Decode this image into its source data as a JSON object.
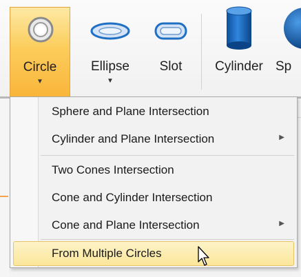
{
  "ribbon": {
    "buttons": [
      {
        "label": "Circle",
        "icon": "circle-icon",
        "has_dropdown": true,
        "active": true
      },
      {
        "label": "Ellipse",
        "icon": "ellipse-icon",
        "has_dropdown": true,
        "active": false
      },
      {
        "label": "Slot",
        "icon": "slot-icon",
        "has_dropdown": false,
        "active": false
      },
      {
        "label": "Cylinder",
        "icon": "cylinder-icon",
        "has_dropdown": false,
        "active": false
      },
      {
        "label": "Sp",
        "icon": "sphere-icon",
        "has_dropdown": false,
        "active": false
      }
    ]
  },
  "menu": {
    "items": [
      {
        "label": "Sphere and Plane Intersection",
        "submenu": false,
        "highlighted": false
      },
      {
        "label": "Cylinder and Plane Intersection",
        "submenu": true,
        "highlighted": false
      },
      {
        "label": "Two Cones Intersection",
        "submenu": false,
        "highlighted": false
      },
      {
        "label": "Cone and Cylinder Intersection",
        "submenu": false,
        "highlighted": false
      },
      {
        "label": "Cone and Plane Intersection",
        "submenu": true,
        "highlighted": false
      },
      {
        "label": "From Multiple Circles",
        "submenu": false,
        "highlighted": true
      }
    ],
    "submenu_arrow": "▶",
    "dropdown_caret": "▼"
  },
  "colors": {
    "active_button": "#fccd5c",
    "highlight": "#fbe69a",
    "icon_blue": "#1f6fc4"
  }
}
